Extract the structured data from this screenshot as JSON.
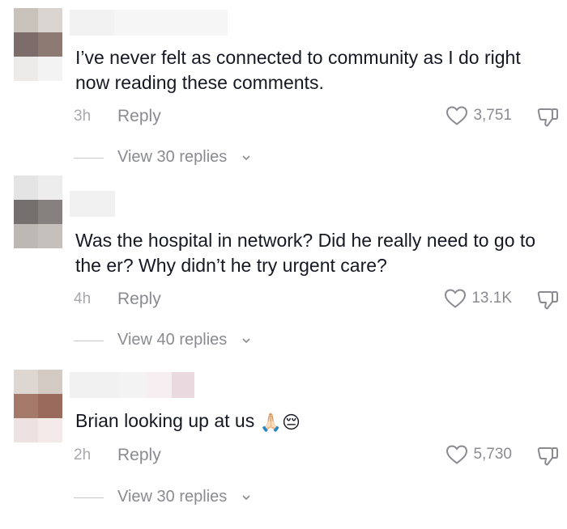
{
  "comments": [
    {
      "text": "I’ve never felt as connected to community as I do right now reading these comments.",
      "time": "3h",
      "reply_label": "Reply",
      "likes": "3,751",
      "view_replies": "View 30 replies"
    },
    {
      "text": "Was the hospital in network? Did he really need to go to the er? Why didn’t he try urgent care?",
      "time": "4h",
      "reply_label": "Reply",
      "likes": "13.1K",
      "view_replies": "View 40 replies"
    },
    {
      "text": "Brian looking up at us",
      "emoji": "🙏🏻😔",
      "time": "2h",
      "reply_label": "Reply",
      "likes": "5,730",
      "view_replies": "View 30 replies"
    }
  ],
  "colors": {
    "text": "#161823",
    "secondary": "#8a8b91",
    "time": "#a8a8ad"
  },
  "icons": {
    "like": "heart-outline-icon",
    "dislike": "thumbs-down-outline-icon",
    "expand": "chevron-down-icon"
  }
}
